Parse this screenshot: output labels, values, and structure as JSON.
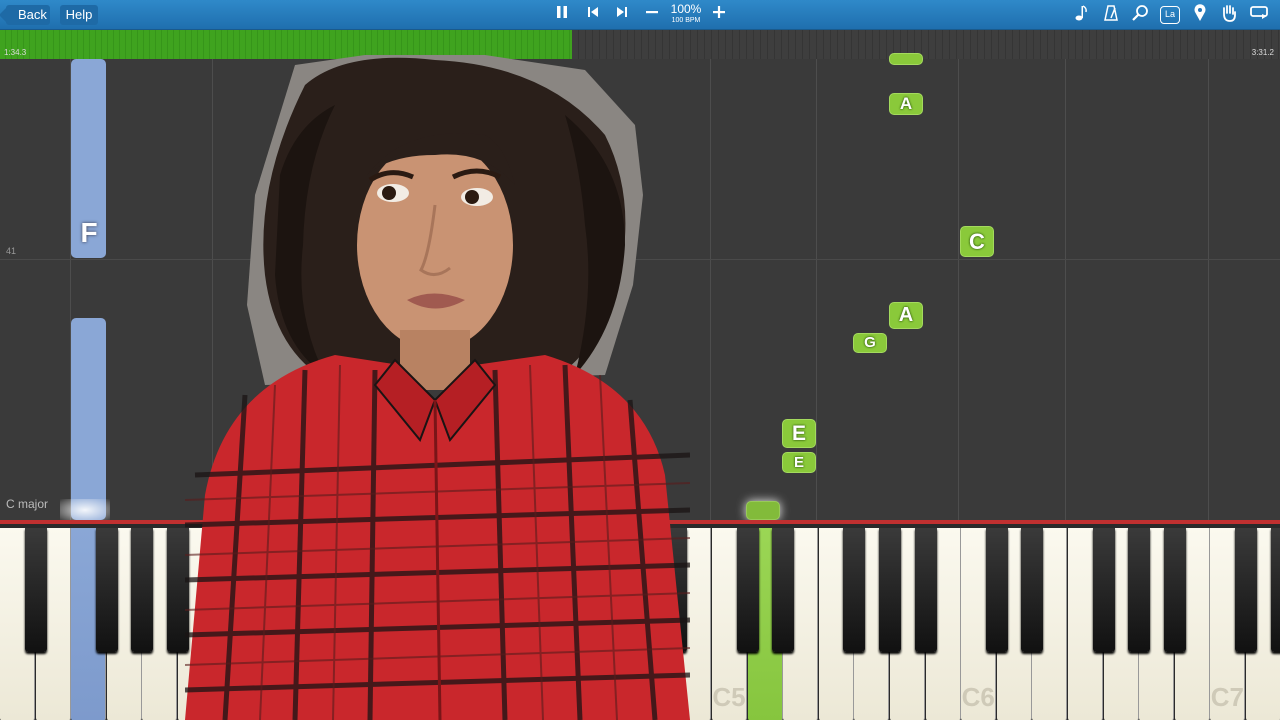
{
  "toolbar": {
    "back_label": "Back",
    "help_label": "Help",
    "tempo_percent": "100%",
    "tempo_bpm": "100 BPM",
    "icons": [
      "pause-icon",
      "previous-icon",
      "next-icon",
      "minus-icon",
      "plus-icon",
      "note-icon",
      "metronome-icon",
      "magnifier-icon",
      "label-icon",
      "pin-icon",
      "hand-icon",
      "loop-icon"
    ],
    "label_icon_text": "La"
  },
  "timeline": {
    "elapsed": "1:34.3",
    "total": "3:31.2",
    "progress_fraction": 0.447
  },
  "roll": {
    "measure_number": "41",
    "key_signature": "C major",
    "left_notes": [
      "F"
    ],
    "notes": [
      "A",
      "A",
      "C",
      "A",
      "G",
      "E",
      "E"
    ]
  },
  "keyboard": {
    "octave_labels": [
      "C5",
      "C6",
      "C7"
    ]
  },
  "colors": {
    "toolbar": "#2a80c2",
    "timeline_progress": "#3fa31f",
    "note_green": "#8ac93a",
    "left_hand_blue": "#8aa7d6",
    "keyboard_border": "#c03030"
  }
}
